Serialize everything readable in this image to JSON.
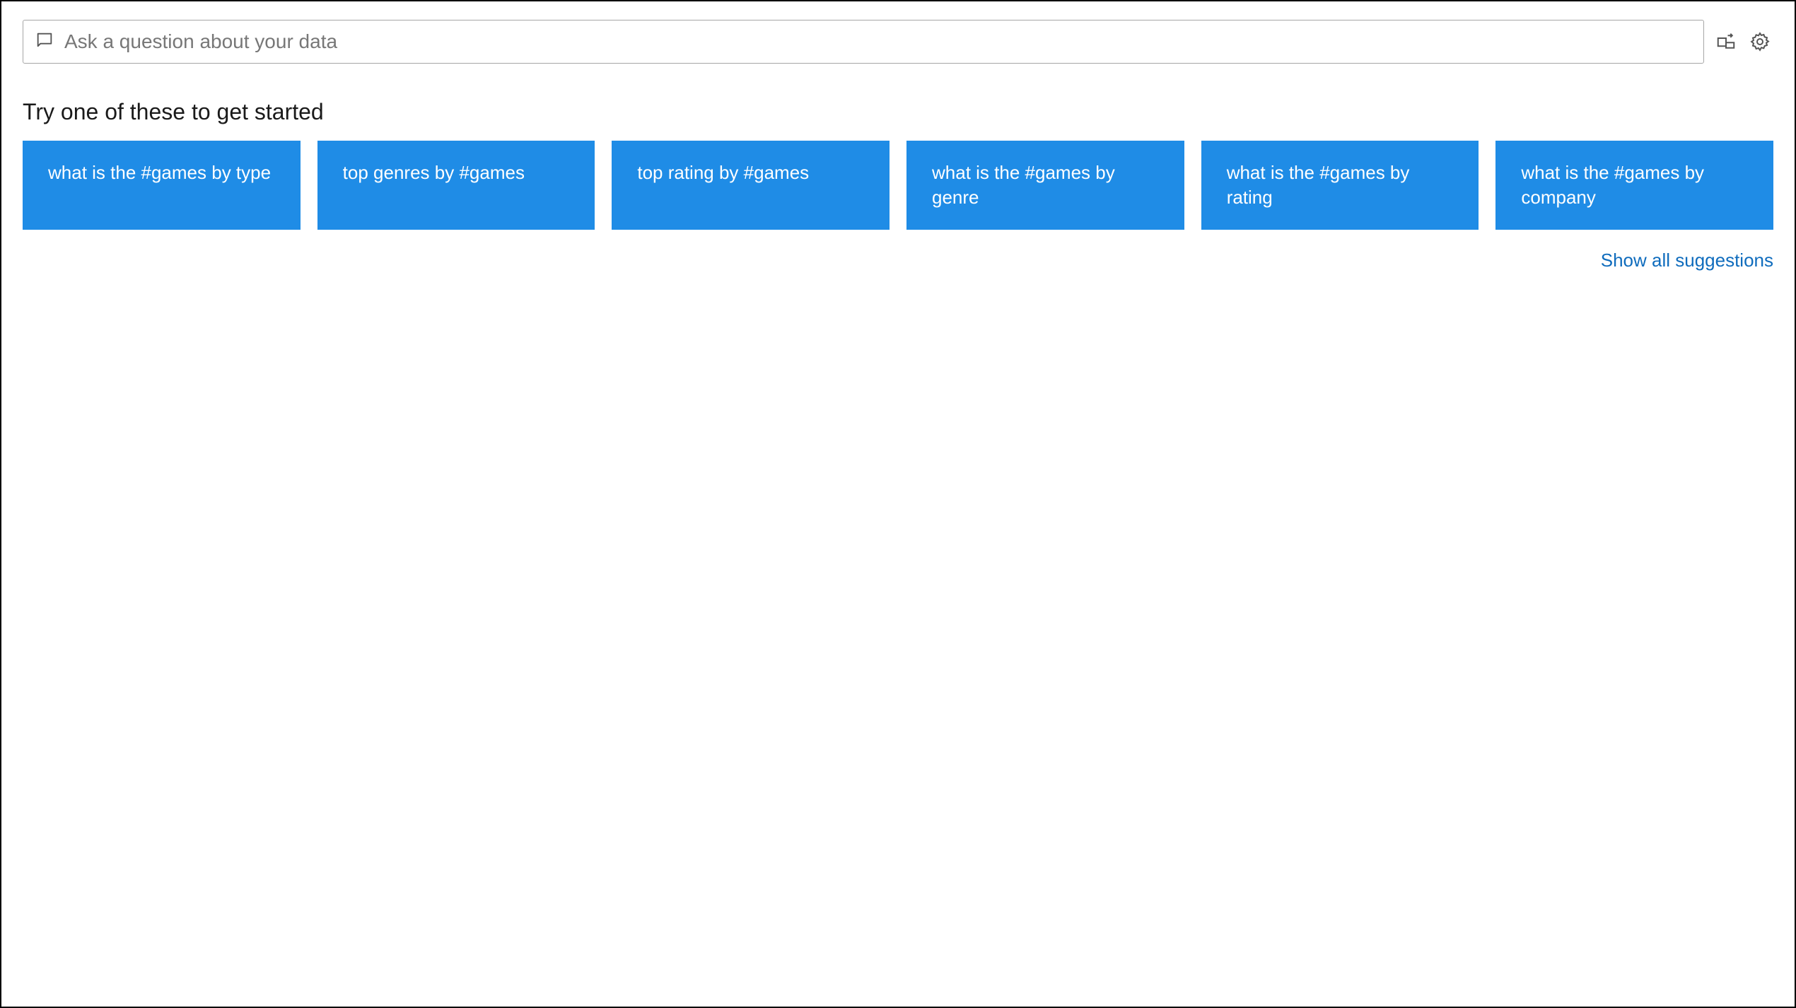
{
  "search": {
    "placeholder": "Ask a question about your data"
  },
  "heading": "Try one of these to get started",
  "cards": [
    "what is the #games by type",
    "top genres by #games",
    "top rating by #games",
    "what is the #games by genre",
    "what is the #games by rating",
    "what is the #games by company"
  ],
  "show_all_label": "Show all suggestions"
}
